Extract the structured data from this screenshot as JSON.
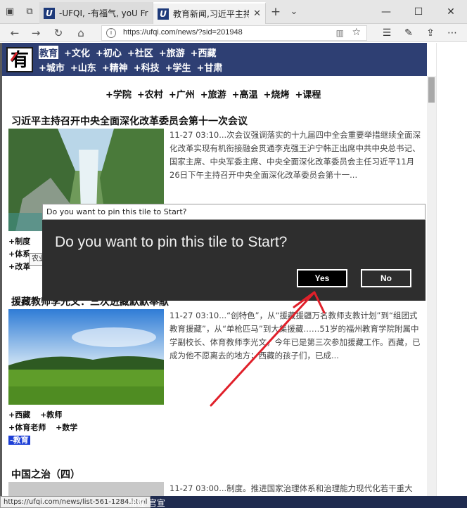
{
  "browser": {
    "tabs": [
      {
        "title": "-UFQI, -有福气, yoU Frqtly Q",
        "favicon": "U",
        "active": false
      },
      {
        "title": "教育新闻,习近平主持召",
        "favicon": "U",
        "active": true
      }
    ],
    "new_tab": "+",
    "url": "https://ufqi.com/news/?sid=201948"
  },
  "site": {
    "logo_char": "有",
    "nav_row1": [
      "教育",
      "+文化",
      "+初心",
      "+社区",
      "+旅游",
      "+西藏"
    ],
    "nav_row2": [
      "+城市",
      "+山东",
      "+精神",
      "+科技",
      "+学生",
      "+甘肃"
    ],
    "tagline": [
      "+学院",
      "+农村",
      "+广州",
      "+旅游",
      "+高温",
      "+烧烤",
      "+课程"
    ]
  },
  "articles": [
    {
      "title": "习近平主持召开中央全面深化改革委员会第十一次会议",
      "summary": "11-27 03:10...次会议强调落实的十九届四中全会重要举措继续全面深化改革实现有机衔接融会贯通李克强王沪宁韩正出席中共中央总书记、国家主席、中央军委主席、中央全面深化改革委员会主任习近平11月26日下午主持召开中央全面深化改革委员会第十一...",
      "tags_row1": [
        "+制度"
      ],
      "tags_row2": [
        "+体系"
      ],
      "tags_row3": [
        "+改革"
      ]
    },
    {
      "title": "援藏教师李光文：三次进藏默默奉献",
      "summary": "11-27 03:10...“创特色”，从“援藏援疆万名教师支教计划”到“组团式教育援藏”，从“单枪匹马”到大集援藏……51岁的福州教育学院附属中学副校长、体育教师李光文，今年已是第三次参加援藏工作。西藏，已成为他不愿离去的地方；西藏的孩子们，已成...",
      "tags_row1": [
        "+西藏",
        "+教师"
      ],
      "tags_row2": [
        "+体育老师",
        "+数学"
      ],
      "tag_highlight": "-教育"
    },
    {
      "title": "中国之治（四）",
      "summary": "11-27 03:00...制度。推进国家治理体系和治理能力现代化若干重大"
    }
  ],
  "dialog": {
    "window_title": "Do you want to pin this tile to Start?",
    "question": "Do you want to pin this tile to Start?",
    "yes_label": "Yes",
    "no_label": "No"
  },
  "tooltip": "农业",
  "status": {
    "hover_url": "https://ufqi.com/news/list-561-1284.html",
    "text": "常在 官宣"
  },
  "colors": {
    "site_header": "#2e3f73",
    "dialog_bg": "#2e2e2e",
    "annotation_arrow": "#e0202a",
    "tag_highlight": "#1d3fd6"
  }
}
